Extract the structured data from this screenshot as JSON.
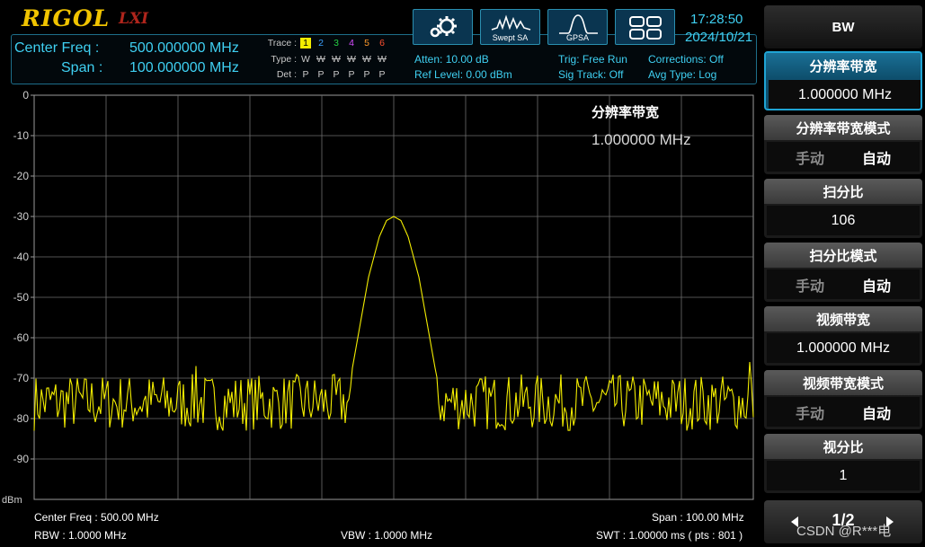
{
  "brand": {
    "logo": "RIGOL",
    "lxi": "LXI"
  },
  "header": {
    "center_freq_label": "Center Freq :",
    "center_freq_value": "500.000000 MHz",
    "span_label": "Span :",
    "span_value": "100.000000 MHz",
    "time": "17:28:50",
    "date": "2024/10/21"
  },
  "trace_table": {
    "trace_label": "Trace :",
    "type_label": "Type :",
    "det_label": "Det :",
    "traces": [
      "1",
      "2",
      "3",
      "4",
      "5",
      "6"
    ],
    "trace_colors": [
      "#f3ed00",
      "#3aa0ff",
      "#25d045",
      "#d34dff",
      "#ff9a2a",
      "#ff5030"
    ],
    "types": [
      "W",
      "W",
      "W",
      "W",
      "W",
      "W"
    ],
    "dets": [
      "P",
      "P",
      "P",
      "P",
      "P",
      "P"
    ]
  },
  "status": {
    "atten": "Atten: 10.00 dB",
    "ref_level": "Ref Level: 0.00 dBm",
    "trig": "Trig: Free Run",
    "sig_track": "Sig Track: Off",
    "corrections": "Corrections: Off",
    "avg_type": "Avg Type: Log"
  },
  "mode_buttons": [
    {
      "icon": "gear-icon",
      "label": ""
    },
    {
      "icon": "swept-sa-icon",
      "label": "Swept SA"
    },
    {
      "icon": "gpsa-icon",
      "label": "GPSA"
    },
    {
      "icon": "window-layout-icon",
      "label": ""
    }
  ],
  "plot": {
    "y_unit": "dBm",
    "overlay_title": "分辨率带宽",
    "overlay_value": "1.000000 MHz"
  },
  "footer": {
    "center_freq": "Center Freq : 500.00 MHz",
    "span": "Span : 100.00 MHz",
    "rbw": "RBW : 1.0000 MHz",
    "vbw": "VBW : 1.0000 MHz",
    "swt": "SWT : 1.00000 ms ( pts : 801 )"
  },
  "softkeys": {
    "title": "BW",
    "rbw": {
      "label": "分辨率带宽",
      "value": "1.000000 MHz"
    },
    "rbw_mode": {
      "label": "分辨率带宽模式",
      "manual": "手动",
      "auto": "自动"
    },
    "span_ratio": {
      "label": "扫分比",
      "value": "106"
    },
    "span_ratio_mode": {
      "label": "扫分比模式",
      "manual": "手动",
      "auto": "自动"
    },
    "vbw": {
      "label": "视频带宽",
      "value": "1.000000 MHz"
    },
    "vbw_mode": {
      "label": "视频带宽模式",
      "manual": "手动",
      "auto": "自动"
    },
    "vbw_rbw_ratio": {
      "label": "视分比",
      "value": "1"
    },
    "page": "1/2"
  },
  "watermark": "CSDN @R***电",
  "chart_data": {
    "type": "line",
    "title": "",
    "xlabel": "",
    "ylabel": "dBm",
    "ylim": [
      -100,
      0
    ],
    "y_ticks": [
      0,
      -10,
      -20,
      -30,
      -40,
      -50,
      -60,
      -70,
      -80,
      -90
    ],
    "x_range_mhz": [
      450,
      550
    ],
    "grid": true,
    "series": [
      {
        "color": "#f3ed00",
        "x": [
          450,
          472,
          480,
          487,
          488,
          490,
          492,
          493.5,
          495,
          496.5,
          498,
          499,
          500,
          501,
          502,
          503.5,
          505,
          506.5,
          508,
          510,
          512,
          520,
          530,
          540,
          550
        ],
        "y": [
          -75,
          -76,
          -67,
          -75,
          -77,
          -76,
          -76,
          -75,
          -60,
          -45,
          -35,
          -31,
          -30,
          -31,
          -35,
          -45,
          -60,
          -75,
          -76,
          -75,
          -76,
          -76,
          -75,
          -76,
          -75
        ],
        "noise_floor_dbm": -76
      }
    ]
  }
}
